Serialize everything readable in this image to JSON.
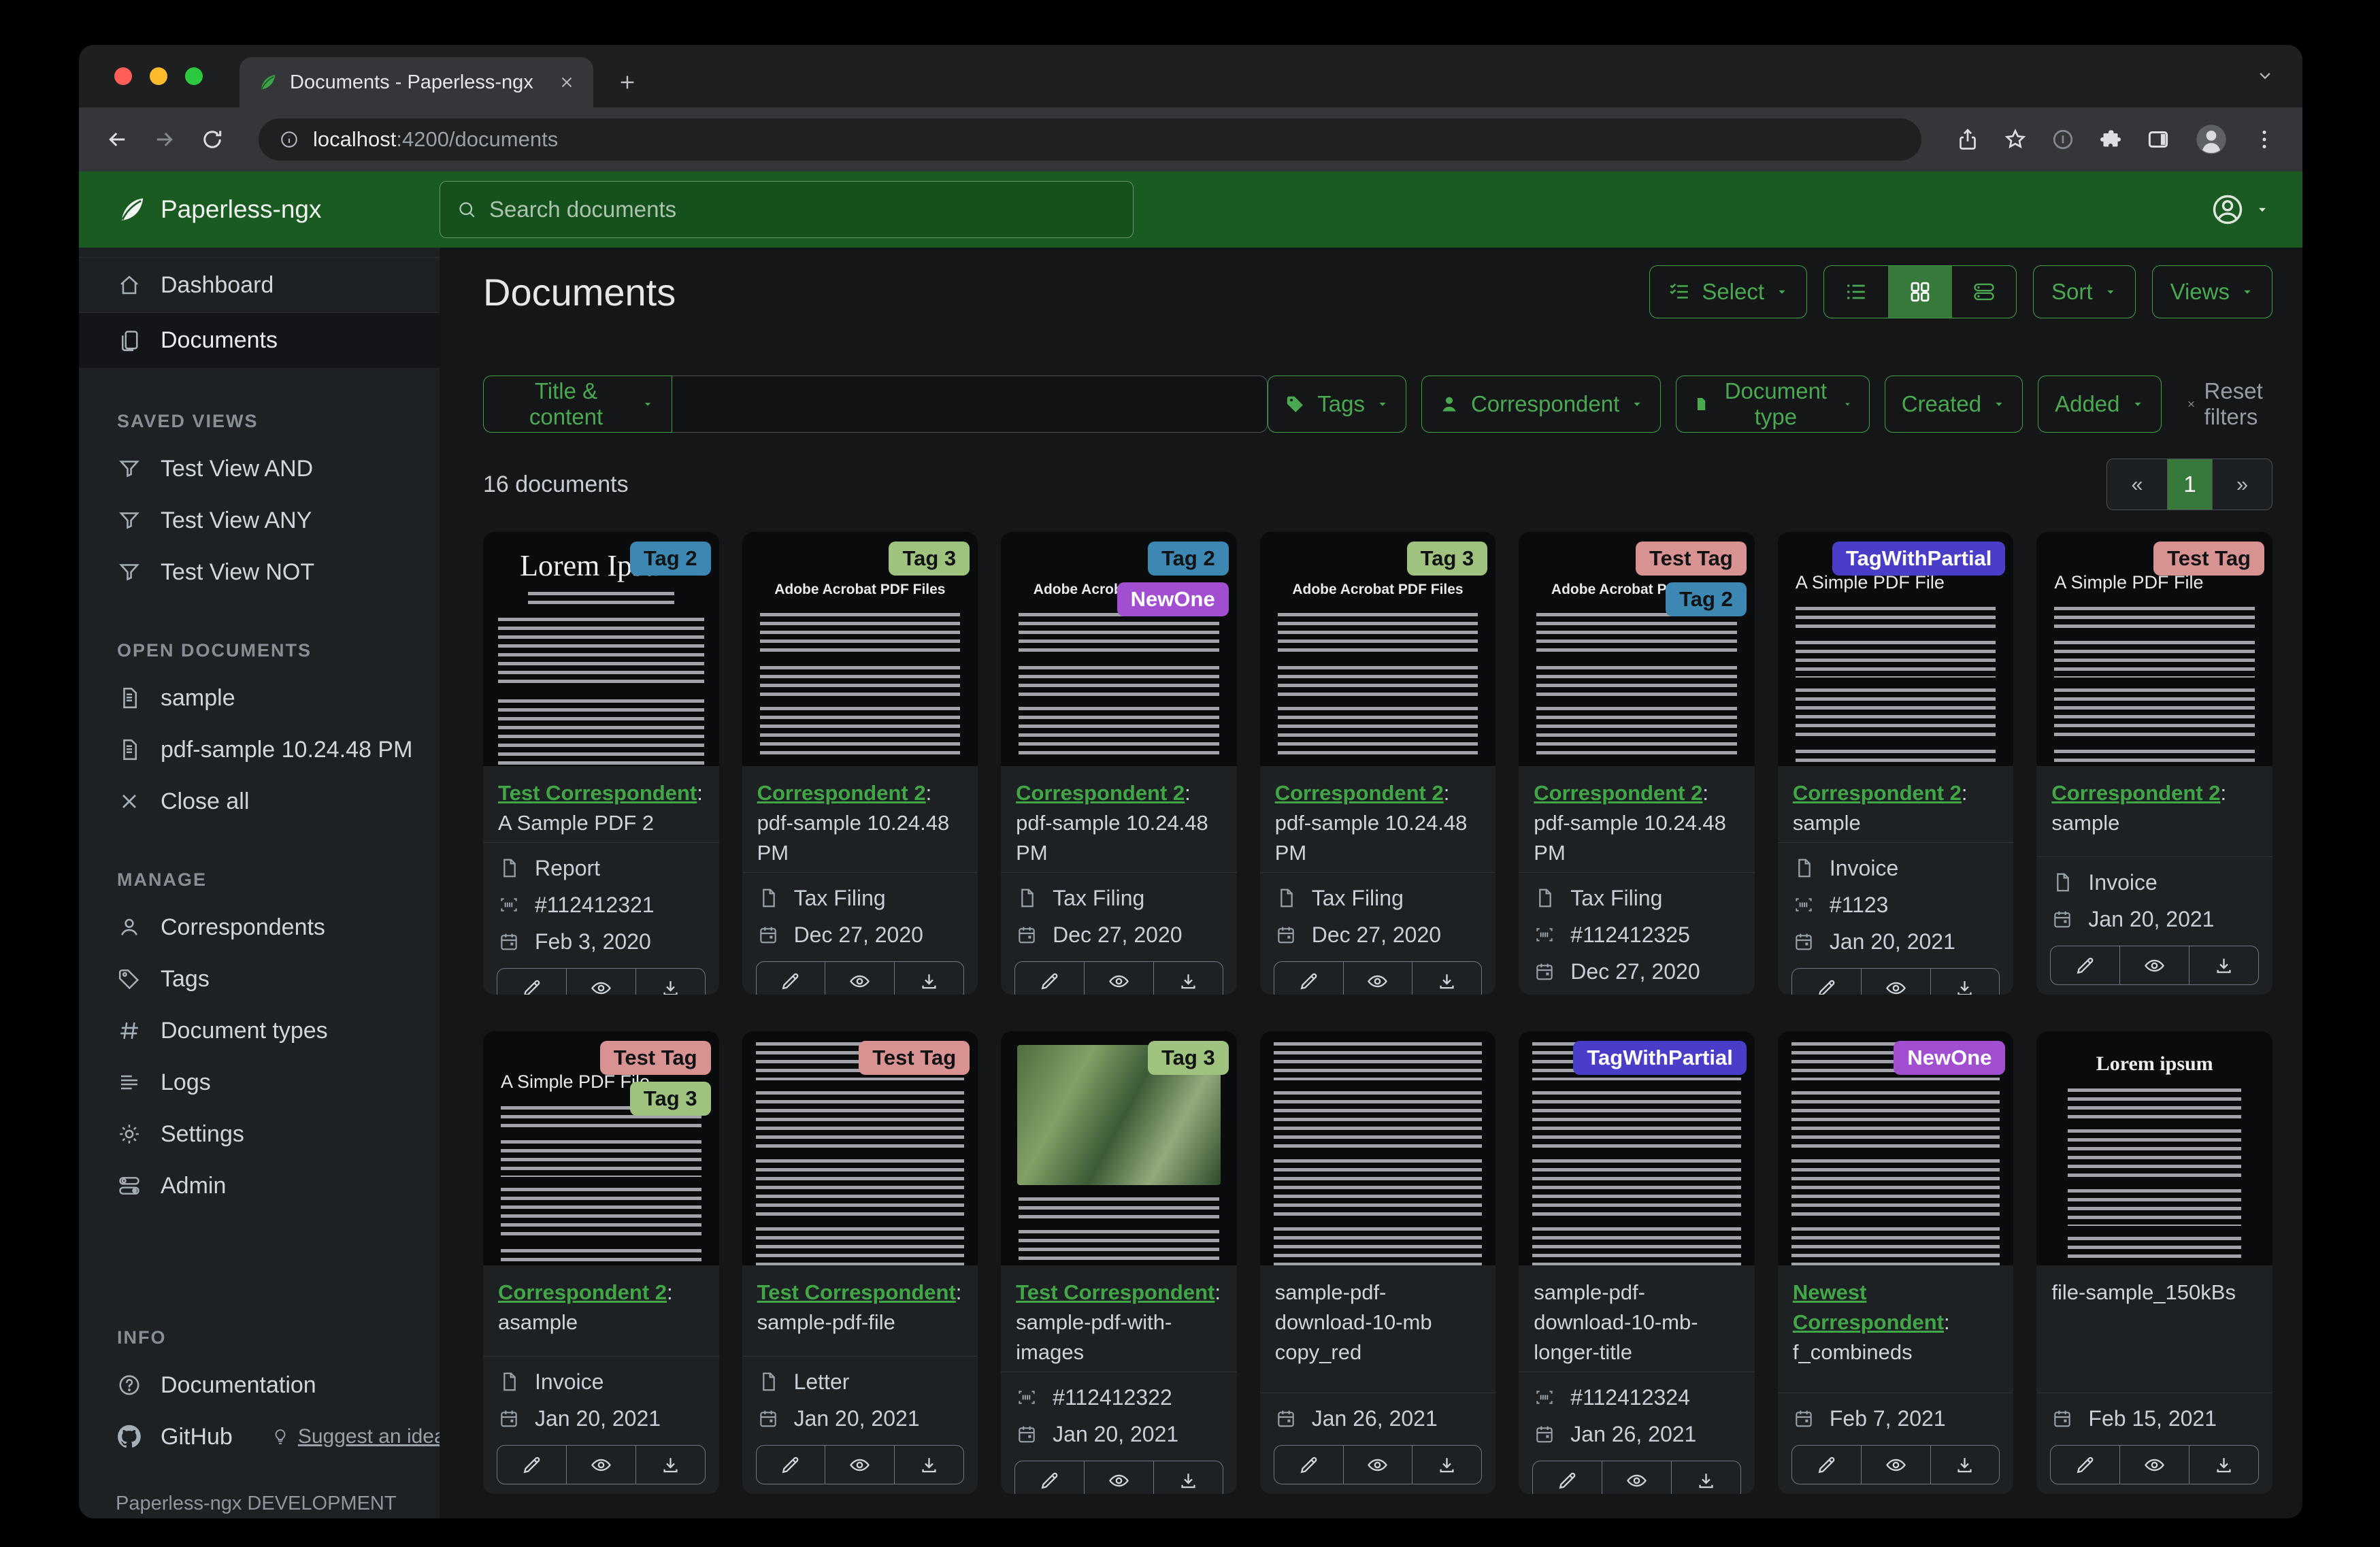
{
  "colors": {
    "accent_green": "#3fa044",
    "header_green": "#1a5b22",
    "active_green": "#36793a"
  },
  "browser": {
    "tab_title": "Documents - Paperless-ngx",
    "url_host": "localhost",
    "url_rest": ":4200/documents"
  },
  "header": {
    "app_name": "Paperless-ngx",
    "search_placeholder": "Search documents"
  },
  "sidebar": {
    "nav": [
      "Dashboard",
      "Documents"
    ],
    "saved_views_header": "SAVED VIEWS",
    "saved_views": [
      "Test View AND",
      "Test View ANY",
      "Test View NOT"
    ],
    "open_documents_header": "OPEN DOCUMENTS",
    "open_documents": [
      "sample",
      "pdf-sample 10.24.48 PM"
    ],
    "close_all": "Close all",
    "manage_header": "MANAGE",
    "manage": [
      "Correspondents",
      "Tags",
      "Document types",
      "Logs",
      "Settings",
      "Admin"
    ],
    "info_header": "INFO",
    "documentation": "Documentation",
    "github": "GitHub",
    "suggest": "Suggest an idea",
    "footer": "Paperless-ngx DEVELOPMENT"
  },
  "toolbar": {
    "title": "Documents",
    "select": "Select",
    "sort": "Sort",
    "views": "Views"
  },
  "filters": {
    "field": "Title & content",
    "input_value": "",
    "tags": "Tags",
    "correspondent": "Correspondent",
    "document_type": "Document type",
    "created": "Created",
    "added": "Added",
    "reset": "Reset filters"
  },
  "status": {
    "count": "16 documents"
  },
  "pagination": {
    "prev": "«",
    "page": "1",
    "next": "»"
  },
  "tag_colors": {
    "Tag 2": {
      "bg": "#3d87b3",
      "fg": "#101214"
    },
    "Tag 3": {
      "bg": "#9fc37f",
      "fg": "#101214"
    },
    "NewOne": {
      "bg": "#a14fd0",
      "fg": "#ffffff"
    },
    "Test Tag": {
      "bg": "#d99292",
      "fg": "#101214"
    },
    "TagWithPartial": {
      "bg": "#4a3ec8",
      "fg": "#ffffff"
    }
  },
  "documents": [
    {
      "tags": [
        "Tag 2"
      ],
      "correspondent": "Test Correspondent",
      "title": "A Sample PDF 2",
      "type": "Report",
      "asn": "#112412321",
      "date": "Feb 3, 2020",
      "thumb": "lorem",
      "thumb_heading": "Lorem Ipsum"
    },
    {
      "tags": [
        "Tag 3"
      ],
      "correspondent": "Correspondent 2",
      "title": "pdf-sample 10.24.48 PM",
      "type": "Tax Filing",
      "date": "Dec 27, 2020",
      "thumb": "acrobat",
      "thumb_heading": "Adobe Acrobat PDF Files"
    },
    {
      "tags": [
        "Tag 2",
        "NewOne"
      ],
      "correspondent": "Correspondent 2",
      "title": "pdf-sample 10.24.48 PM",
      "type": "Tax Filing",
      "date": "Dec 27, 2020",
      "thumb": "acrobat",
      "thumb_heading": "Adobe Acrobat PDF Files"
    },
    {
      "tags": [
        "Tag 3"
      ],
      "correspondent": "Correspondent 2",
      "title": "pdf-sample 10.24.48 PM",
      "type": "Tax Filing",
      "date": "Dec 27, 2020",
      "thumb": "acrobat",
      "thumb_heading": "Adobe Acrobat PDF Files"
    },
    {
      "tags": [
        "Test Tag",
        "Tag 2"
      ],
      "correspondent": "Correspondent 2",
      "title": "pdf-sample 10.24.48 PM",
      "type": "Tax Filing",
      "asn": "#112412325",
      "date": "Dec 27, 2020",
      "thumb": "acrobat",
      "thumb_heading": "Adobe Acrobat PDF Files"
    },
    {
      "tags": [
        "TagWithPartial"
      ],
      "correspondent": "Correspondent 2",
      "title": "sample",
      "type": "Invoice",
      "asn": "#1123",
      "date": "Jan 20, 2021",
      "thumb": "simple",
      "thumb_heading": "A Simple PDF File"
    },
    {
      "tags": [
        "Test Tag"
      ],
      "correspondent": "Correspondent 2",
      "title": "sample",
      "type": "Invoice",
      "date": "Jan 20, 2021",
      "thumb": "simple",
      "thumb_heading": "A Simple PDF File"
    },
    {
      "tags": [
        "Test Tag",
        "Tag 3"
      ],
      "correspondent": "Correspondent 2",
      "title": "asample",
      "type": "Invoice",
      "date": "Jan 20, 2021",
      "thumb": "simple",
      "thumb_heading": "A Simple PDF File"
    },
    {
      "tags": [
        "Test Tag"
      ],
      "correspondent": "Test Correspondent",
      "title": "sample-pdf-file",
      "type": "Letter",
      "date": "Jan 20, 2021",
      "thumb": "dense"
    },
    {
      "tags": [
        "Tag 3"
      ],
      "correspondent": "Test Correspondent",
      "title": "sample-pdf-with-images",
      "asn": "#112412322",
      "date": "Jan 20, 2021",
      "thumb": "map"
    },
    {
      "tags": [],
      "title": "sample-pdf-download-10-mb copy_red",
      "date": "Jan 26, 2021",
      "thumb": "dense"
    },
    {
      "tags": [
        "TagWithPartial"
      ],
      "title": "sample-pdf-download-10-mb-longer-title",
      "asn": "#112412324",
      "date": "Jan 26, 2021",
      "thumb": "dense"
    },
    {
      "tags": [
        "NewOne"
      ],
      "correspondent": "Newest Correspondent",
      "title": "f_combineds",
      "date": "Feb 7, 2021",
      "thumb": "dense"
    },
    {
      "tags": [],
      "title": "file-sample_150kBs",
      "date": "Feb 15, 2021",
      "thumb": "lorem2",
      "thumb_heading": "Lorem ipsum"
    }
  ]
}
